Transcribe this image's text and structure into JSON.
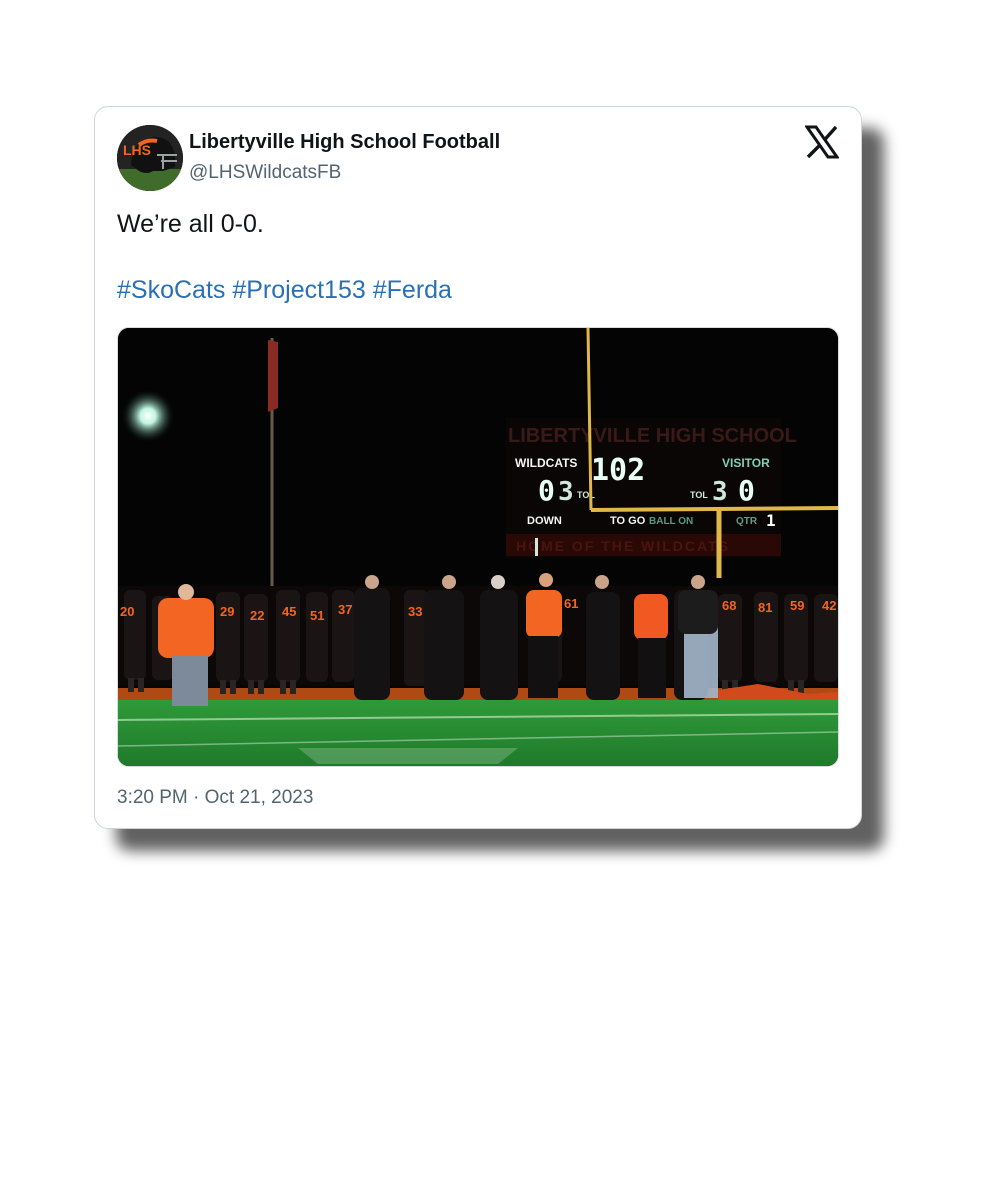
{
  "tweet": {
    "author_name": "Libertyville High School Football",
    "author_handle": "@LHSWildcatsFB",
    "text": "We’re all 0-0.",
    "hashtags": [
      "#SkoCats",
      "#Project153",
      "#Ferda"
    ],
    "timestamp": "3:20 PM · Oct 21, 2023",
    "platform_icon": "x-logo-icon"
  },
  "avatar": {
    "icon": "football-helmet-icon",
    "text": "LHS"
  },
  "photo": {
    "scoreboard": {
      "title": "LIBERTYVILLE HIGH SCHOOL",
      "home_label": "WILDCATS",
      "visitor_label": "VISITOR",
      "clock": "102",
      "home_score": "0",
      "home_tol": "3",
      "visitor_tol": "3",
      "visitor_score": "0",
      "tol_label": "TOL",
      "down_label": "DOWN",
      "to_go_label": "TO GO",
      "ball_on_label": "BALL ON",
      "qtr_label": "QTR",
      "qtr_value": "1",
      "footer": "HOME OF THE WILDCATS"
    },
    "jerseys": [
      "20",
      "29",
      "22",
      "45",
      "51",
      "37",
      "33",
      "61",
      "68",
      "81",
      "59",
      "42"
    ]
  },
  "colors": {
    "link": "#2a70b3",
    "text": "#0f1419",
    "secondary": "#536471",
    "brand_orange": "#f26522"
  }
}
